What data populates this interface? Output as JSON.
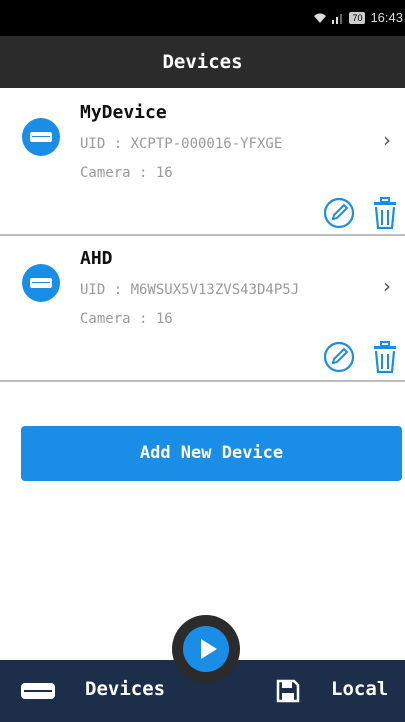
{
  "status_bar": {
    "time": "16:43",
    "battery": "70"
  },
  "header": {
    "title": "Devices"
  },
  "devices": [
    {
      "name": "MyDevice",
      "uid": "UID : XCPTP-000016-YFXGE",
      "camera": "Camera : 16"
    },
    {
      "name": "AHD",
      "uid": "UID : M6WSUX5V13ZVS43D4P5J",
      "camera": "Camera : 16"
    }
  ],
  "add_button": {
    "label": "Add New Device"
  },
  "bottom_nav": {
    "devices_label": "Devices",
    "local_label": "Local"
  },
  "colors": {
    "accent": "#1a8ee6",
    "header": "#2b2b2b",
    "bottom_bar": "#1c2e4a"
  },
  "icons": [
    "wifi-icon",
    "signal-icon",
    "battery-icon",
    "device-icon",
    "chevron-right-icon",
    "edit-icon",
    "trash-icon",
    "play-icon",
    "dvr-icon",
    "save-icon"
  ]
}
